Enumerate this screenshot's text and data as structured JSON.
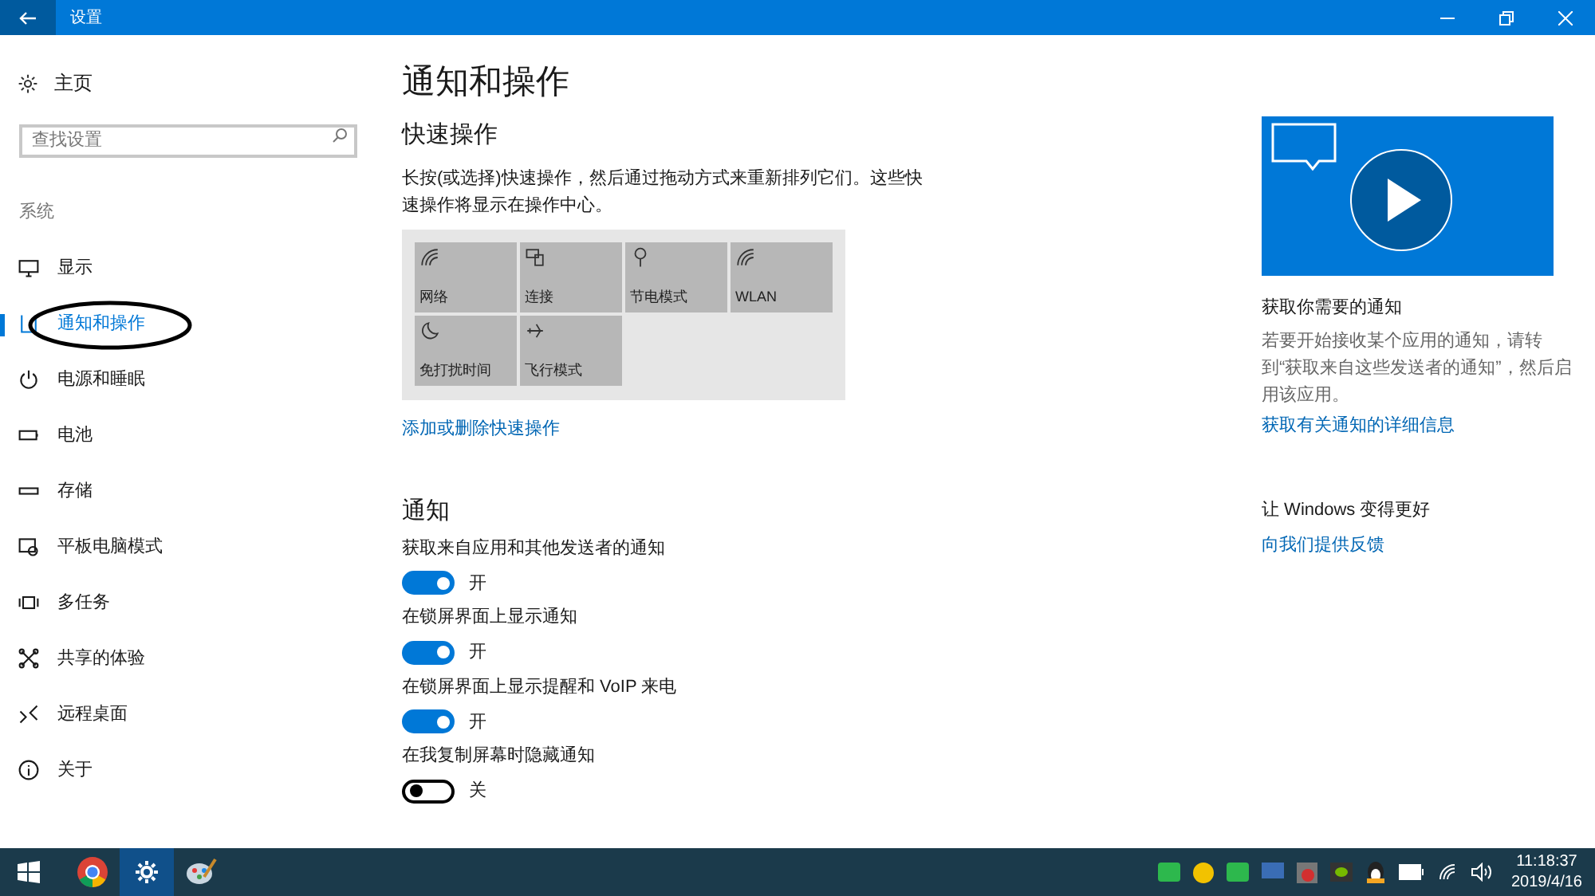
{
  "window": {
    "title": "设置"
  },
  "sidebar": {
    "home": "主页",
    "search": {
      "placeholder": "查找设置"
    },
    "section": "系统",
    "items": [
      {
        "label": "显示",
        "kind": "display",
        "selected": false
      },
      {
        "label": "通知和操作",
        "kind": "notifications",
        "selected": true
      },
      {
        "label": "电源和睡眠",
        "kind": "power",
        "selected": false
      },
      {
        "label": "电池",
        "kind": "battery",
        "selected": false
      },
      {
        "label": "存储",
        "kind": "storage",
        "selected": false
      },
      {
        "label": "平板电脑模式",
        "kind": "tablet",
        "selected": false
      },
      {
        "label": "多任务",
        "kind": "multitask",
        "selected": false
      },
      {
        "label": "共享的体验",
        "kind": "share",
        "selected": false
      },
      {
        "label": "远程桌面",
        "kind": "remote",
        "selected": false
      },
      {
        "label": "关于",
        "kind": "about",
        "selected": false
      }
    ]
  },
  "main": {
    "title": "通知和操作",
    "quick_actions": {
      "heading": "快速操作",
      "description": "长按(或选择)快速操作，然后通过拖动方式来重新排列它们。这些快速操作将显示在操作中心。",
      "tiles": [
        {
          "label": "网络",
          "kind": "network"
        },
        {
          "label": "连接",
          "kind": "connect"
        },
        {
          "label": "节电模式",
          "kind": "saver"
        },
        {
          "label": "WLAN",
          "kind": "wifi"
        },
        {
          "label": "免打扰时间",
          "kind": "moon"
        },
        {
          "label": "飞行模式",
          "kind": "airplane"
        }
      ],
      "link": "添加或删除快速操作"
    },
    "notifications": {
      "heading": "通知",
      "settings": [
        {
          "label": "获取来自应用和其他发送者的通知",
          "on": true,
          "state_text": "开"
        },
        {
          "label": "在锁屏界面上显示通知",
          "on": true,
          "state_text": "开"
        },
        {
          "label": "在锁屏界面上显示提醒和 VoIP 来电",
          "on": true,
          "state_text": "开"
        },
        {
          "label": "在我复制屏幕时隐藏通知",
          "on": false,
          "state_text": "关"
        }
      ]
    }
  },
  "side_panel": {
    "heading": "获取你需要的通知",
    "text": "若要开始接收某个应用的通知，请转到“获取来自这些发送者的通知”，然后启用该应用。",
    "link": "获取有关通知的详细信息",
    "feedback_heading": "让 Windows 变得更好",
    "feedback_link": "向我们提供反馈"
  },
  "taskbar": {
    "apps": [
      {
        "kind": "start",
        "selected": false
      },
      {
        "kind": "chrome",
        "selected": false
      },
      {
        "kind": "settings",
        "selected": true
      },
      {
        "kind": "paint",
        "selected": false
      }
    ],
    "clock": {
      "time": "11:18:37",
      "date": "2019/4/16"
    }
  }
}
